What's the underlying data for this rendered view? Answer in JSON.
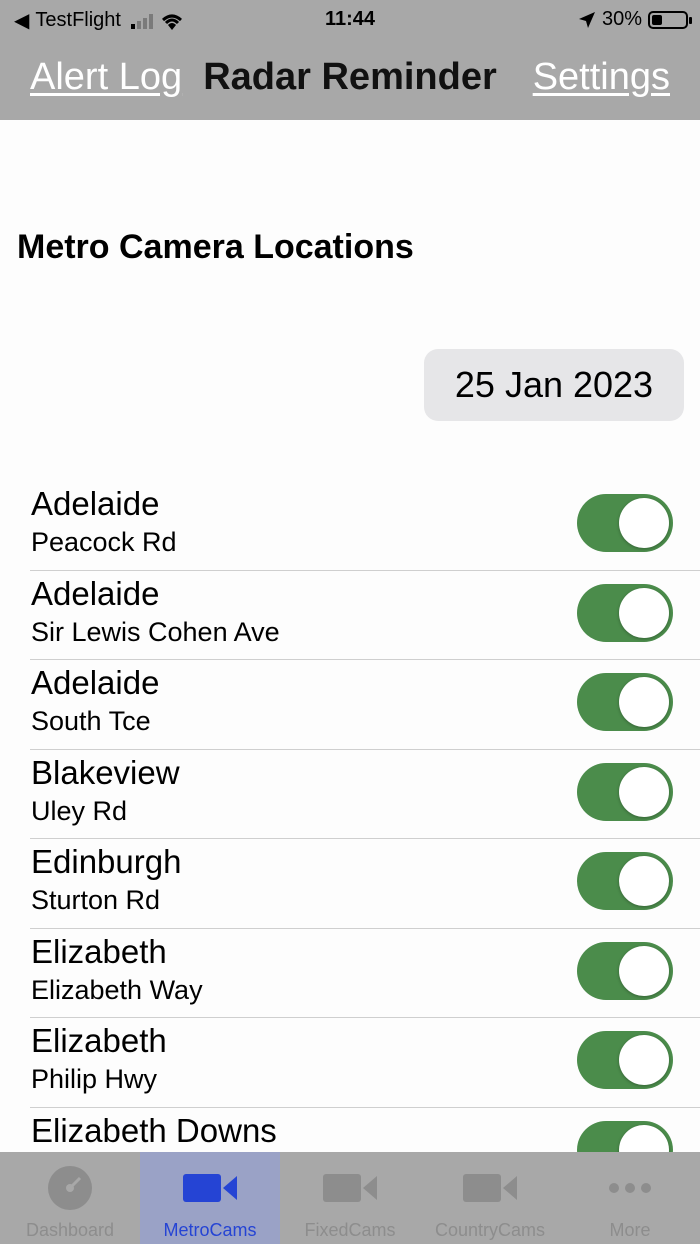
{
  "status_bar": {
    "back_app": "TestFlight",
    "time": "11:44",
    "battery": "30%"
  },
  "nav": {
    "left": "Alert Log",
    "title": "Radar Reminder",
    "right": "Settings"
  },
  "section_title": "Metro Camera Locations",
  "date": "25 Jan 2023",
  "cameras": [
    {
      "city": "Adelaide",
      "road": "Peacock Rd",
      "enabled": true
    },
    {
      "city": "Adelaide",
      "road": "Sir Lewis Cohen Ave",
      "enabled": true
    },
    {
      "city": "Adelaide",
      "road": "South Tce",
      "enabled": true
    },
    {
      "city": "Blakeview",
      "road": "Uley Rd",
      "enabled": true
    },
    {
      "city": "Edinburgh",
      "road": "Sturton Rd",
      "enabled": true
    },
    {
      "city": "Elizabeth",
      "road": "Elizabeth Way",
      "enabled": true
    },
    {
      "city": "Elizabeth",
      "road": "Philip Hwy",
      "enabled": true
    },
    {
      "city": "Elizabeth Downs",
      "road": "",
      "enabled": true
    }
  ],
  "tabs": [
    {
      "label": "Dashboard",
      "icon": "gauge-icon"
    },
    {
      "label": "MetroCams",
      "icon": "video-camera-icon"
    },
    {
      "label": "FixedCams",
      "icon": "video-camera-icon"
    },
    {
      "label": "CountryCams",
      "icon": "video-camera-icon"
    },
    {
      "label": "More",
      "icon": "more-icon"
    }
  ],
  "colors": {
    "header_bg": "#a8a8a8",
    "toggle_on": "#4b8c4b",
    "active_tab": "#2544d4"
  }
}
